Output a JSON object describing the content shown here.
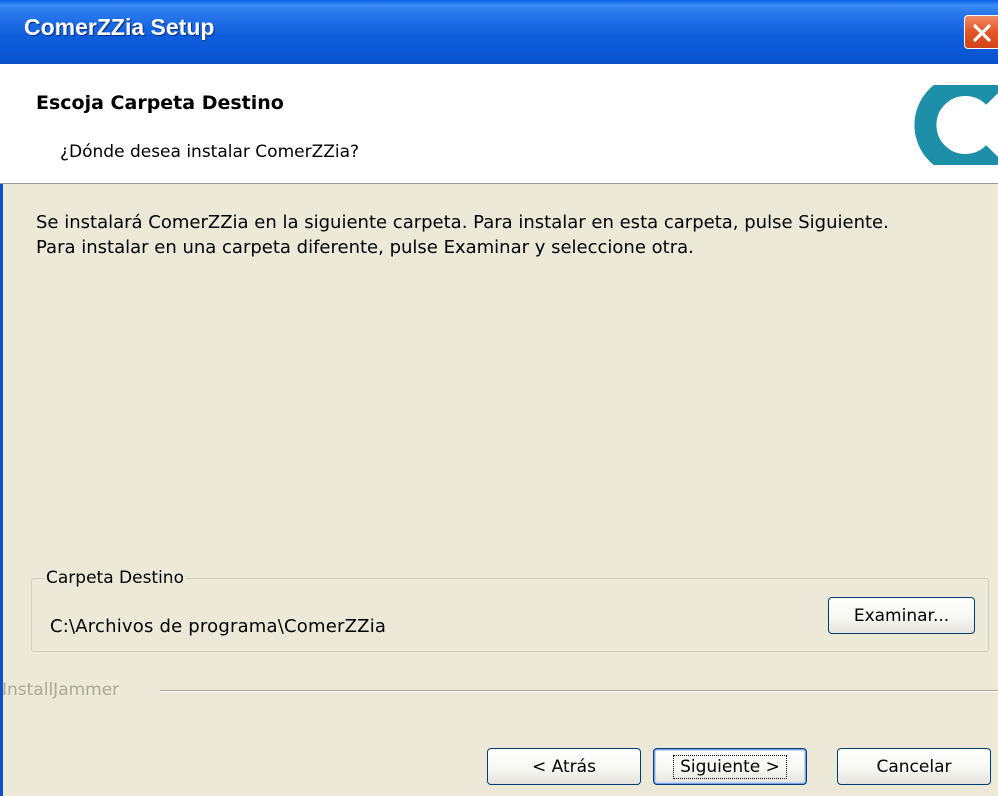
{
  "window": {
    "title": "ComerZZia Setup"
  },
  "header": {
    "title": "Escoja Carpeta Destino",
    "subtitle": "¿Dónde desea instalar ComerZZia?",
    "logo_icon": "comerzzia-c-logo-icon",
    "logo_color": "#1e8fa8"
  },
  "body": {
    "line1": "Se instalará ComerZZia en la siguiente carpeta. Para instalar en esta carpeta, pulse Siguiente.",
    "line2": "Para instalar en una carpeta diferente, pulse Examinar y seleccione otra."
  },
  "destination": {
    "legend": "Carpeta Destino",
    "path": "C:\\Archivos de programa\\ComerZZia",
    "browse_label": "Examinar..."
  },
  "footer": {
    "brand": "InstallJammer",
    "back_label": "< Atrás",
    "next_label": "Siguiente >",
    "cancel_label": "Cancelar"
  },
  "colors": {
    "titlebar": "#0a5ee7",
    "background": "#ece9d8",
    "close_button": "#e4582c"
  }
}
